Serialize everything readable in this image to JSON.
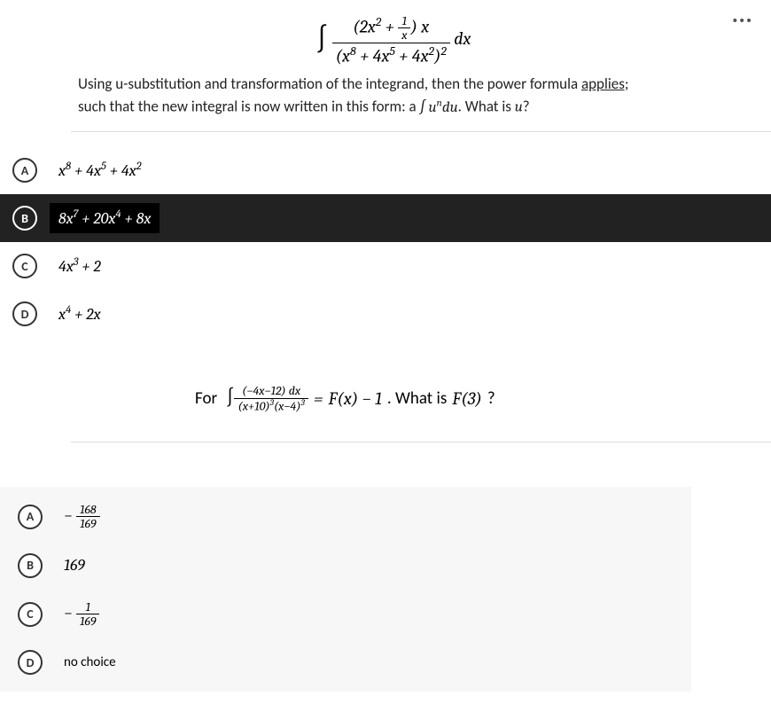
{
  "question1": {
    "more_icon": "···",
    "integral_numerator_open": "(",
    "integral_2x2": "2x",
    "integral_2x2_exp": "2",
    "integral_plus": " + ",
    "integral_1": "1",
    "integral_x_den": "x",
    "integral_close_paren": ")",
    "integral_times_x": " x",
    "integral_den_open": "(x",
    "integral_den_e8": "8",
    "integral_den_mid1": " + 4x",
    "integral_den_e5": "5",
    "integral_den_mid2": " + 4x",
    "integral_den_e2": "2",
    "integral_den_close": ")",
    "integral_den_sq_exp": "2",
    "integral_dx": " dx",
    "explain_1": "Using u-substitution and transformation of the integrand, then the power formula ",
    "explain_applies": "applies;",
    "explain_2_a": "such that the new integral is now written in this form:   a ",
    "explain_int": "∫ u",
    "explain_n": "n",
    "explain_du": "du",
    "explain_2_b": ". What is ",
    "explain_u": "u",
    "explain_q": "?",
    "options": [
      {
        "letter": "A",
        "html": "x<sup>8</sup> + 4x<sup>5</sup> + 4x<sup>2</sup>",
        "selected": false
      },
      {
        "letter": "B",
        "html": "8x<sup>7</sup> + 20x<sup>4</sup> + 8x",
        "selected": true
      },
      {
        "letter": "C",
        "html": "4x<sup>3</sup> + 2",
        "selected": false
      },
      {
        "letter": "D",
        "html": "x<sup>4</sup> + 2x",
        "selected": false
      }
    ]
  },
  "question2": {
    "for_label": "For",
    "int_num": "(−4x−12) dx",
    "int_den_a": "(x+10)",
    "int_den_a_exp": "3",
    "int_den_b": "(x−4)",
    "int_den_b_exp": "3",
    "eq": " = ",
    "rhs_fx": "F(x) − 1",
    "rhs_rest": ". What is ",
    "rhs_f3": "F(3)",
    "rhs_q": "?",
    "options": [
      {
        "letter": "A",
        "type": "frac",
        "neg": true,
        "num": "168",
        "den": "169"
      },
      {
        "letter": "B",
        "type": "plain",
        "text": "169"
      },
      {
        "letter": "C",
        "type": "frac",
        "neg": true,
        "num": "1",
        "den": "169"
      },
      {
        "letter": "D",
        "type": "text",
        "text": "no choice"
      }
    ]
  }
}
